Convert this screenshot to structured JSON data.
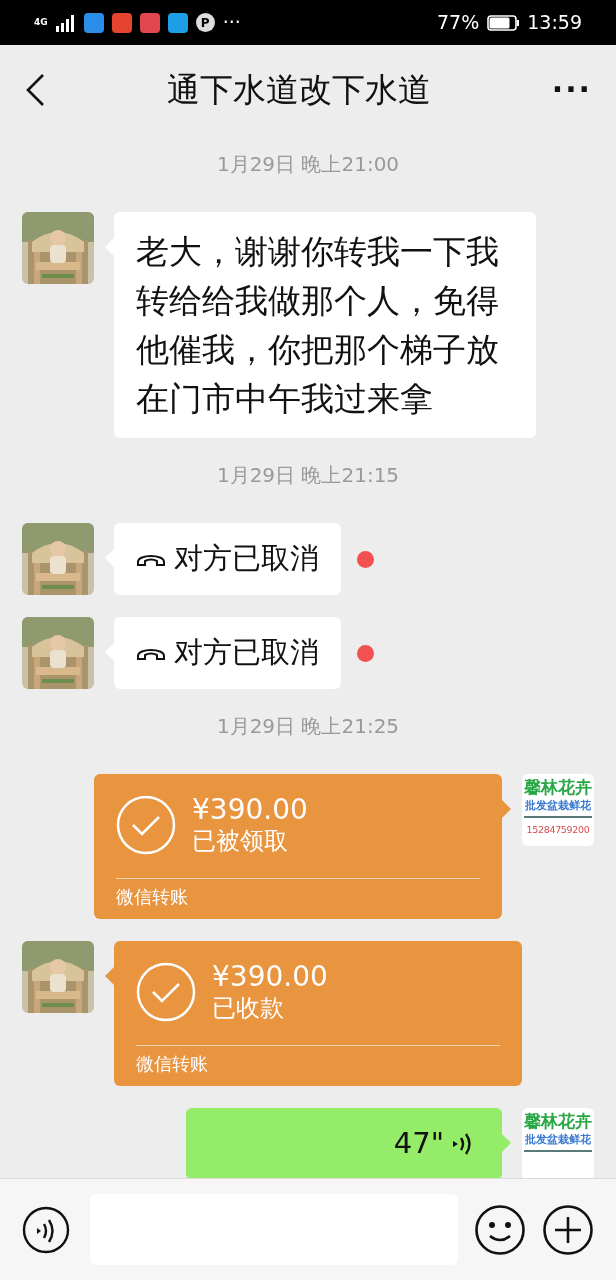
{
  "status_bar": {
    "network": "4G",
    "notification_icons": [
      {
        "color": "#2a8de8"
      },
      {
        "color": "#e5442e"
      },
      {
        "color": "#e0474f"
      },
      {
        "color": "#1c9fe4"
      }
    ],
    "p_badge": "P",
    "more": "···",
    "battery_text": "77%",
    "time": "13:59"
  },
  "header": {
    "title": "通下水道改下水道",
    "more": "···"
  },
  "messages": [
    {
      "kind": "time",
      "text": "1月29日 晚上21:00"
    },
    {
      "kind": "text",
      "outgoing": false,
      "text": "老大，谢谢你转我一下我转给给我做那个人，免得他催我，你把那个梯子放在门市中午我过来拿"
    },
    {
      "kind": "time",
      "text": "1月29日 晚上21:15"
    },
    {
      "kind": "call",
      "outgoing": false,
      "text": "对方已取消",
      "unread": true
    },
    {
      "kind": "call",
      "outgoing": false,
      "text": "对方已取消",
      "unread": true
    },
    {
      "kind": "time",
      "text": "1月29日 晚上21:25"
    },
    {
      "kind": "transfer",
      "outgoing": true,
      "amount": "¥390.00",
      "status": "已被领取",
      "label": "微信转账",
      "avatar": [
        {
          "kind": "brand",
          "text": "馨林花卉"
        },
        {
          "kind": "tagline",
          "text": "批发盆栽鲜花"
        },
        {
          "kind": "phone",
          "text": "15284759200"
        }
      ]
    },
    {
      "kind": "transfer",
      "outgoing": false,
      "amount": "¥390.00",
      "status": "已收款",
      "label": "微信转账"
    },
    {
      "kind": "voice",
      "outgoing": true,
      "duration": "47\"",
      "avatar": [
        {
          "kind": "brand",
          "text": "馨林花卉"
        },
        {
          "kind": "tagline",
          "text": "批发盆栽鲜花"
        }
      ]
    }
  ]
}
